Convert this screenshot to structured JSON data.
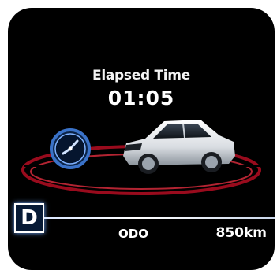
{
  "display": {
    "title": "Elapsed Time",
    "elapsed_time": "01:05",
    "gear": "D",
    "odometer_label": "ODO",
    "odometer_value": "850km"
  },
  "icons": {
    "clock": "clock-icon",
    "car": "car-image"
  },
  "colors": {
    "background": "#000000",
    "text": "#ffffff",
    "accent_arc": "#c8102e",
    "clock_blue": "#3a72c8",
    "gear_box": "#071a35"
  }
}
